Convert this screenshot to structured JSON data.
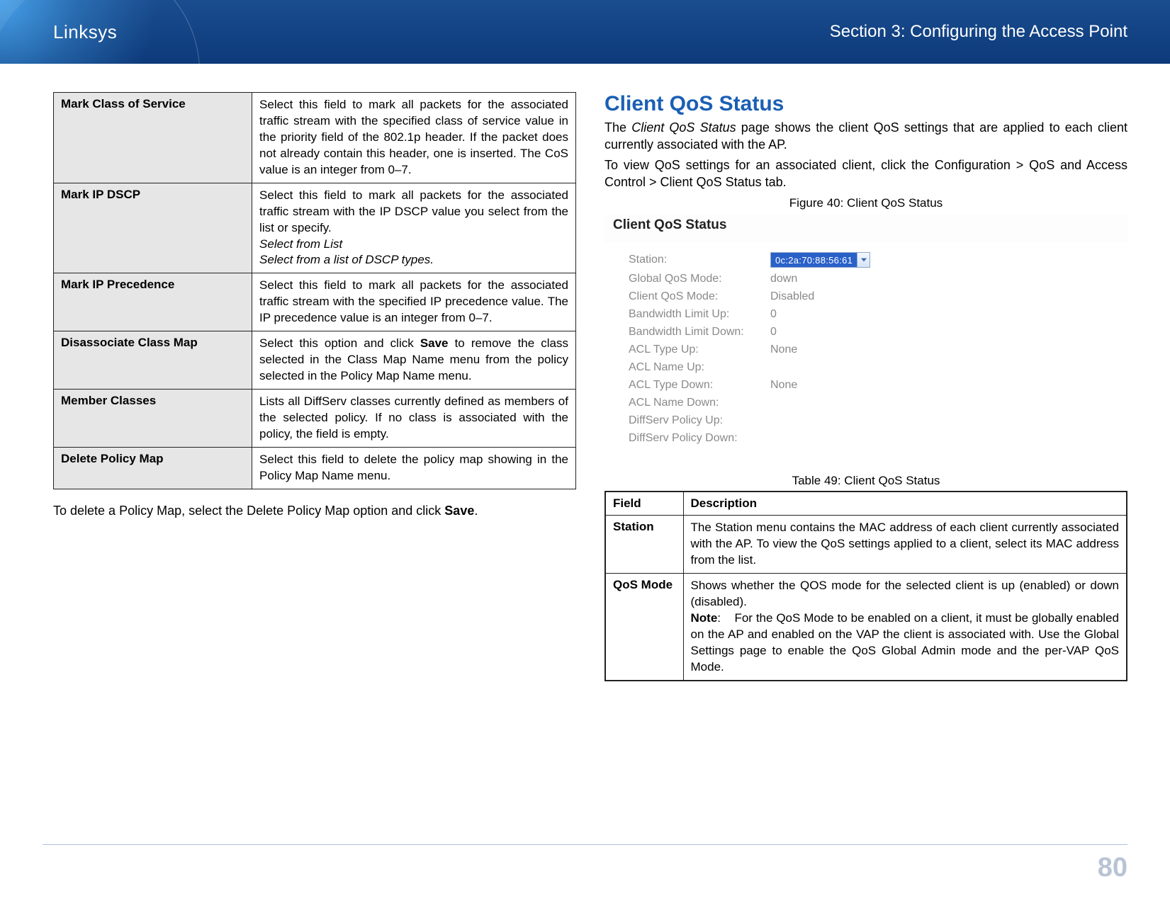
{
  "header": {
    "brand": "Linksys",
    "section": "Section 3:  Configuring the Access Point"
  },
  "leftTable": [
    {
      "label": "Mark Class of Service",
      "desc": "Select this field to mark all packets for the associated traffic stream with the specified class of service value in the priority field of the 802.1p header. If the packet does not already contain this header, one is inserted. The CoS value is an integer from 0–7."
    },
    {
      "label": "Mark IP DSCP",
      "desc": "Select this field to mark all packets for the associated traffic stream with the IP DSCP value you select from the list or specify.",
      "extra1": "Select from List",
      "extra2": "Select from a list of DSCP types."
    },
    {
      "label": "Mark IP Precedence",
      "desc": "Select this field to mark all packets for the associated traffic stream with the specified IP precedence value. The IP precedence value is an integer from 0–7."
    },
    {
      "label": "Disassociate Class Map",
      "desc": "Select this option and click <b>Save</b> to remove the class selected in the Class Map Name menu from the policy selected in the Policy Map Name menu."
    },
    {
      "label": "Member Classes",
      "desc": "Lists all DiffServ classes currently defined as members of the selected policy. If no class is associated with the policy, the field is empty."
    },
    {
      "label": "Delete Policy Map",
      "desc": "Select this field to delete the policy map showing in the Policy Map Name menu."
    }
  ],
  "afterText": {
    "pre": "To delete a Policy Map, select the Delete Policy Map option and click ",
    "bold": "Save",
    "post": "."
  },
  "right": {
    "heading": "Client QoS Status",
    "intro1a": "The ",
    "intro1em": "Client QoS Status",
    "intro1b": " page shows the client QoS settings that are applied to each client currently associated with the AP.",
    "intro2": "To view QoS settings for an associated client, click the Configuration > QoS and Access Control > Client QoS Status tab.",
    "figCaption": "Figure 40: Client QoS Status",
    "screenshot": {
      "title": "Client QoS Status",
      "station": {
        "label": "Station:",
        "value": "0c:2a:70:88:56:61"
      },
      "rows": [
        {
          "label": "Global QoS Mode:",
          "value": "down"
        },
        {
          "label": "Client QoS Mode:",
          "value": "Disabled"
        },
        {
          "label": "Bandwidth Limit Up:",
          "value": "0"
        },
        {
          "label": "Bandwidth Limit Down:",
          "value": "0"
        },
        {
          "label": "ACL Type Up:",
          "value": "None"
        },
        {
          "label": "ACL Name Up:",
          "value": ""
        },
        {
          "label": "ACL Type Down:",
          "value": "None"
        },
        {
          "label": "ACL Name Down:",
          "value": ""
        },
        {
          "label": "DiffServ Policy Up:",
          "value": ""
        },
        {
          "label": "DiffServ Policy Down:",
          "value": ""
        }
      ]
    },
    "tblCaption": "Table 49: Client QoS Status",
    "fieldsHeader": {
      "field": "Field",
      "desc": "Description"
    },
    "fields": [
      {
        "label": "Station",
        "desc": "The Station menu contains the MAC address of each client currently associated with the AP. To view the QoS settings applied to a client, select its MAC address from the list."
      },
      {
        "label": "QoS Mode",
        "desc": "Shows whether the QOS mode for the selected client is up (enabled) or down (disabled).<br><b>Note</b>:&nbsp;&nbsp;&nbsp;&nbsp;For the QoS Mode to be enabled on a client, it must be globally enabled on the AP and enabled on the VAP the client is associated with. Use the Global Settings page to enable the QoS Global Admin mode and the per-VAP QoS Mode."
      }
    ]
  },
  "pageNumber": "80"
}
